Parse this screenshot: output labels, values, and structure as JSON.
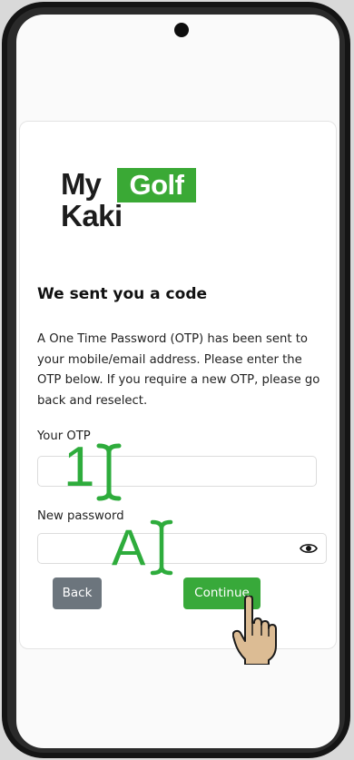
{
  "logo": {
    "line1": "My",
    "badge": "Golf",
    "line2": "Kaki",
    "brand_color": "#3aa935"
  },
  "title": "We sent you a code",
  "description": "A One Time Password (OTP) has been sent to your mobile/email address. Please enter the OTP below. If you require a new OTP, please go back and reselect.",
  "otp_field": {
    "label": "Your OTP",
    "value": "",
    "annotation": "1"
  },
  "password_field": {
    "label": "New password",
    "value": "",
    "annotation": "A",
    "toggle_icon": "eye-icon"
  },
  "buttons": {
    "back": "Back",
    "continue": "Continue"
  },
  "colors": {
    "continue": "#38a93a",
    "back": "#6c757d",
    "annotation": "#2eac3c"
  }
}
